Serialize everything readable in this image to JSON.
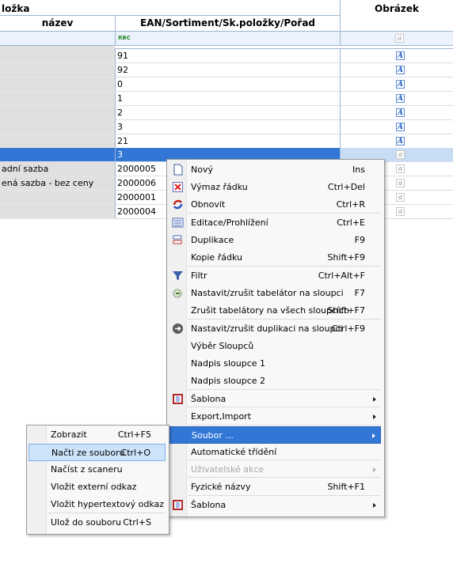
{
  "grid": {
    "group_header_left": "ložka",
    "group_header_right": "Obrázek",
    "col_name": "název",
    "col_ean": "EAN/Sortiment/Sk.položky/Pořad",
    "filter_badge": "RBC",
    "rows": [
      {
        "name": "",
        "ean": "91",
        "img": "A"
      },
      {
        "name": "",
        "ean": "92",
        "img": "A"
      },
      {
        "name": "",
        "ean": "0",
        "img": "A"
      },
      {
        "name": "",
        "ean": "1",
        "img": "A"
      },
      {
        "name": "",
        "ean": "2",
        "img": "A"
      },
      {
        "name": "",
        "ean": "3",
        "img": "A"
      },
      {
        "name": "",
        "ean": "21",
        "img": "A"
      },
      {
        "name": "",
        "ean": "3",
        "img": "a"
      },
      {
        "name": "adní sazba",
        "ean": "2000005",
        "img": "a"
      },
      {
        "name": "ená sazba - bez ceny",
        "ean": "2000006",
        "img": "a"
      },
      {
        "name": "",
        "ean": "2000001",
        "img": "a"
      },
      {
        "name": "",
        "ean": "2000004",
        "img": "a"
      }
    ]
  },
  "context_menu": {
    "items": [
      {
        "label": "Nový",
        "shortcut": "Ins",
        "icon": "new-document-icon"
      },
      {
        "label": "Výmaz řádku",
        "shortcut": "Ctrl+Del",
        "icon": "delete-row-icon"
      },
      {
        "label": "Obnovit",
        "shortcut": "Ctrl+R",
        "icon": "refresh-icon"
      },
      {
        "label": "Editace/Prohlížení",
        "shortcut": "Ctrl+E",
        "icon": "edit-view-icon"
      },
      {
        "label": "Duplikace",
        "shortcut": "F9",
        "icon": "duplicate-icon"
      },
      {
        "label": "Kopie řádku",
        "shortcut": "Shift+F9",
        "icon": ""
      },
      {
        "label": "Filtr",
        "shortcut": "Ctrl+Alt+F",
        "icon": "filter-icon"
      },
      {
        "label": "Nastavit/zrušit tabelátor na sloupci",
        "shortcut": "F7",
        "icon": "tab-stop-icon"
      },
      {
        "label": "Zrušit tabelátory na všech sloupcích",
        "shortcut": "Shift+F7",
        "icon": ""
      },
      {
        "label": "Nastavit/zrušit duplikaci na sloupci",
        "shortcut": "Ctrl+F9",
        "icon": "arrow-circle-icon"
      },
      {
        "label": "Výběr Sloupců",
        "shortcut": "",
        "icon": ""
      },
      {
        "label": "Nadpis sloupce  1",
        "shortcut": "",
        "icon": ""
      },
      {
        "label": "Nadpis sloupce 2",
        "shortcut": "",
        "icon": ""
      },
      {
        "label": "Šablona",
        "shortcut": "",
        "icon": "template-icon"
      },
      {
        "label": "Export,Import",
        "shortcut": "",
        "icon": ""
      },
      {
        "label": "Soubor ...",
        "shortcut": "",
        "icon": ""
      },
      {
        "label": "Automatické třídění",
        "shortcut": "",
        "icon": ""
      },
      {
        "label": "Uživatelské akce",
        "shortcut": "",
        "icon": ""
      },
      {
        "label": "Fyzické názvy",
        "shortcut": "Shift+F1",
        "icon": ""
      },
      {
        "label": "Šablona",
        "shortcut": "",
        "icon": "template-icon"
      }
    ]
  },
  "submenu": {
    "items": [
      {
        "label": "Zobrazit",
        "shortcut": "Ctrl+F5"
      },
      {
        "label": "Načti ze souboru",
        "shortcut": "Ctrl+O"
      },
      {
        "label": "Načíst z scaneru",
        "shortcut": ""
      },
      {
        "label": "Vložit externí odkaz",
        "shortcut": ""
      },
      {
        "label": "Vložit hypertextový odkaz",
        "shortcut": ""
      },
      {
        "label": "Ulož do souboru",
        "shortcut": "Ctrl+S"
      }
    ]
  },
  "colors": {
    "selection": "#3377d6",
    "hover": "#cde3fa",
    "grid_border": "#9fb4d0"
  }
}
